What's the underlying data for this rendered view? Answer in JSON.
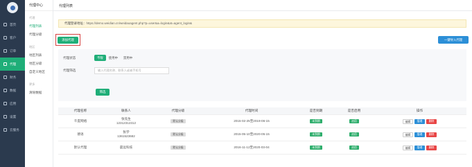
{
  "nav": {
    "items": [
      {
        "label": "首页",
        "icon": "home-icon"
      },
      {
        "label": "客户",
        "icon": "user-icon"
      },
      {
        "label": "订单",
        "icon": "order-icon"
      },
      {
        "label": "代理",
        "icon": "agent-icon"
      },
      {
        "label": "财务",
        "icon": "finance-icon"
      },
      {
        "label": "数据",
        "icon": "chart-icon"
      },
      {
        "label": "应用",
        "icon": "apps-icon"
      },
      {
        "label": "设置",
        "icon": "settings-icon"
      },
      {
        "label": "云服务",
        "icon": "cloud-icon"
      }
    ],
    "active_index": 3
  },
  "subnav": {
    "title": "代理中心",
    "group1": "代理",
    "item_list": "代理列表",
    "item_tiers": "代理分级",
    "group2": "地区",
    "item_region_list": "地区列表",
    "item_region_tiers": "地区分级",
    "item_custom_region": "自定义地区",
    "group3": "更多",
    "item_clear_data": "清除数据"
  },
  "header": {
    "title": "代理列表"
  },
  "url_bar": {
    "label": "代理登录地址：",
    "url": "https://demo.weidian.cn/weidaoagent.php?p=user&a=login&at=agent_login&"
  },
  "buttons": {
    "add": "添加代理",
    "import": "一键导入代理",
    "search": "筛选"
  },
  "filter": {
    "status_label": "代理状态",
    "status_options": [
      "不限",
      "使用中",
      "禁用中"
    ],
    "status_selected": 0,
    "search_label": "代理筛选",
    "search_placeholder": "输入代理名称、联系人或者手机号"
  },
  "table": {
    "headers": [
      "代理名称",
      "联系人",
      "代理分级",
      "代理时间",
      "是否到期",
      "是否启用",
      "操作"
    ],
    "rows": [
      {
        "name": "千度网络",
        "contact": "张先生",
        "phone": "12312312312",
        "tier": "默认分级",
        "period": "2015-02-25至2019-06-15",
        "expired": "未到期",
        "enabled": "启用"
      },
      {
        "name": "德语",
        "contact": "张学",
        "phone": "1361523682",
        "tier": "默认分级",
        "period": "2015-05-10至2020-05-15",
        "expired": "未到期",
        "enabled": "启用"
      },
      {
        "name": "默认代理",
        "contact": "晨远科技",
        "phone": "",
        "tier": "默认分级",
        "period": "2016-11-12至2020-03-04",
        "expired": "未到期",
        "enabled": "启用"
      }
    ],
    "actions": {
      "edit": "编辑",
      "manage": "管理",
      "delete": "删除"
    }
  },
  "colors": {
    "accent": "#1fae78",
    "sidebar": "#2b3a4e",
    "primary_blue": "#2c8fd7",
    "danger": "#e84545",
    "notice_bg": "#fdf6dc"
  }
}
